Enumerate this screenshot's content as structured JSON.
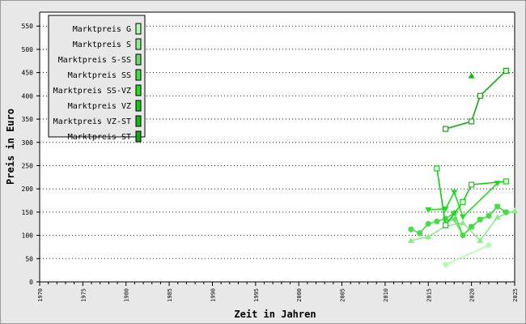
{
  "chart_data": {
    "type": "line",
    "title": "",
    "xlabel": "Zeit in Jahren",
    "ylabel": "Preis in Euro",
    "xlim": [
      1970,
      2025
    ],
    "ylim": [
      0,
      580
    ],
    "x_ticks": [
      "1970",
      "1975",
      "1980",
      "1985",
      "1990",
      "1995",
      "2000",
      "2005",
      "2010",
      "2015",
      "2020",
      "2025"
    ],
    "y_ticks": [
      "0",
      "50",
      "100",
      "150",
      "200",
      "250",
      "300",
      "350",
      "400",
      "450",
      "500",
      "550"
    ],
    "grid": "horizontal-dotted",
    "legend_position": "top-left",
    "series": [
      {
        "name": "Marktpreis G",
        "color": "#aaffaa",
        "marker": "diamond",
        "points": [
          [
            2017,
            37
          ],
          [
            2022,
            79
          ]
        ]
      },
      {
        "name": "Marktpreis S",
        "color": "#88ee88",
        "marker": "triangle-up",
        "points": [
          [
            2013,
            89
          ],
          [
            2015,
            97
          ],
          [
            2017,
            120
          ],
          [
            2019,
            127
          ],
          [
            2021,
            89
          ],
          [
            2023,
            139
          ],
          [
            2025,
            153
          ]
        ]
      },
      {
        "name": "Marktpreis S-SS",
        "color": "#66dd66",
        "marker": "triangle-down",
        "points": [
          [
            2017,
            130
          ],
          [
            2018,
            134
          ],
          [
            2019,
            100
          ],
          [
            2020,
            119
          ],
          [
            2021,
            134
          ],
          [
            2022,
            142
          ],
          [
            2023,
            162
          ],
          [
            2024,
            150
          ]
        ]
      },
      {
        "name": "Marktpreis SS",
        "color": "#44dd44",
        "marker": "circle",
        "points": [
          [
            2013,
            113
          ],
          [
            2014,
            105
          ],
          [
            2015,
            125
          ],
          [
            2016,
            130
          ],
          [
            2017,
            136
          ],
          [
            2018,
            148
          ],
          [
            2019,
            100
          ],
          [
            2020,
            118
          ],
          [
            2021,
            134
          ],
          [
            2022,
            142
          ],
          [
            2023,
            162
          ],
          [
            2024,
            150
          ]
        ]
      },
      {
        "name": "Marktpreis SS-VZ",
        "color": "#22dd22",
        "marker": "triangle-down",
        "points": [
          [
            2015,
            155
          ],
          [
            2017,
            157
          ],
          [
            2018,
            193
          ],
          [
            2019,
            140
          ],
          [
            2023,
            212
          ]
        ]
      },
      {
        "name": "Marktpreis VZ",
        "color": "#11cc11",
        "marker": "square",
        "points": [
          [
            2016,
            244
          ],
          [
            2017,
            122
          ],
          [
            2019,
            172
          ],
          [
            2020,
            209
          ],
          [
            2024,
            216
          ]
        ]
      },
      {
        "name": "Marktpreis VZ-ST",
        "color": "#11bb11",
        "marker": "triangle-up",
        "points": [
          [
            2020,
            443
          ]
        ]
      },
      {
        "name": "Marktpreis ST",
        "color": "#11aa11",
        "marker": "square",
        "points": [
          [
            2017,
            329
          ],
          [
            2020,
            345
          ],
          [
            2021,
            400
          ],
          [
            2024,
            454
          ]
        ]
      }
    ]
  }
}
